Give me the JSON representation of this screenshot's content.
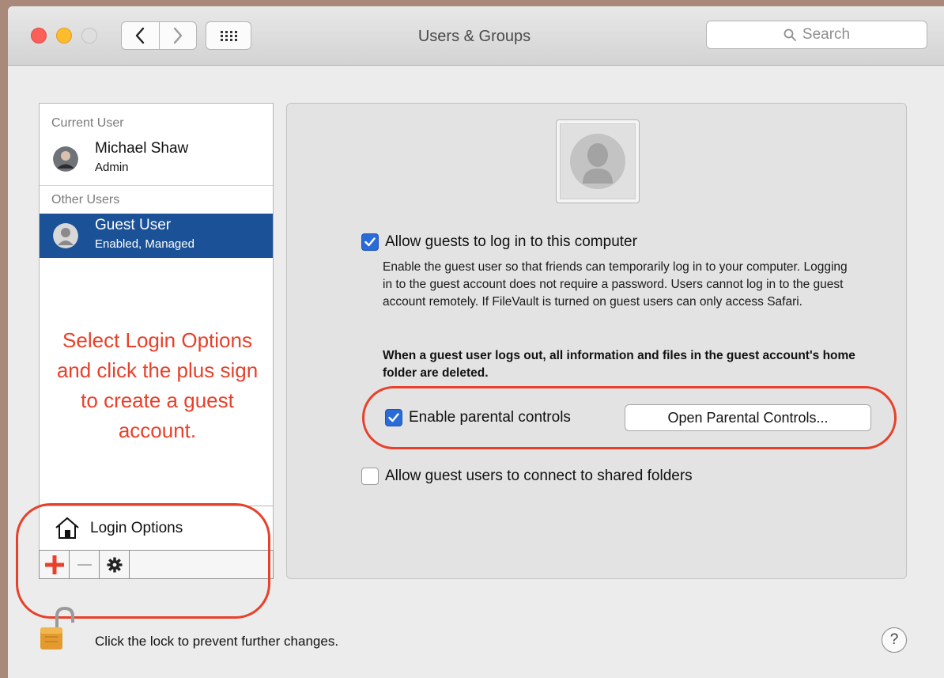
{
  "window": {
    "title": "Users & Groups",
    "search_placeholder": "Search"
  },
  "sidebar": {
    "current_user_header": "Current User",
    "current_user": {
      "name": "Michael Shaw",
      "role": "Admin"
    },
    "other_users_header": "Other Users",
    "guest_user": {
      "name": "Guest User",
      "status": "Enabled, Managed"
    },
    "login_options_label": "Login Options"
  },
  "annotation": "Select Login Options and click the plus sign to create a guest account.",
  "panel": {
    "allow_guests_label": "Allow guests to log in to this computer",
    "allow_guests_checked": true,
    "description": "Enable the guest user so that friends can temporarily log in to your computer. Logging in to the guest account does not require a password. Users cannot log in to the guest account remotely. If FileVault is turned on guest users can only access Safari.",
    "warning": "When a guest user logs out, all information and files in the guest account's home folder are deleted.",
    "parental_controls_label": "Enable parental controls",
    "parental_controls_checked": true,
    "open_parental_controls_label": "Open Parental Controls...",
    "shared_folders_label": "Allow guest users to connect to shared folders",
    "shared_folders_checked": false
  },
  "footer": {
    "lock_text": "Click the lock to prevent further changes.",
    "help_label": "?"
  },
  "colors": {
    "selection": "#1b5196",
    "checkbox_on": "#2a6bd7",
    "annotation": "#e8402a"
  },
  "icons": [
    "back-chevron-icon",
    "forward-chevron-icon",
    "grid-icon",
    "search-icon",
    "user-avatar-icon",
    "house-icon",
    "plus-icon",
    "minus-icon",
    "gear-icon",
    "unlocked-padlock-icon",
    "help-icon",
    "checkmark-icon"
  ]
}
